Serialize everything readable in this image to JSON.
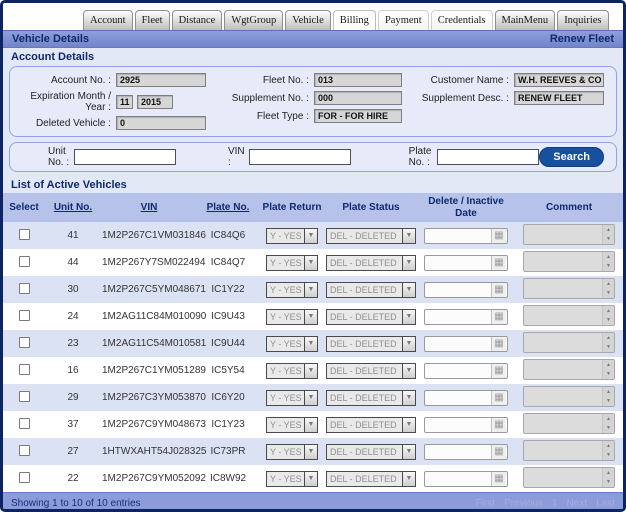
{
  "tabs": [
    {
      "label": "Account",
      "style": "gray"
    },
    {
      "label": "Fleet",
      "style": "gray"
    },
    {
      "label": "Distance",
      "style": "gray"
    },
    {
      "label": "WgtGroup",
      "style": "gray"
    },
    {
      "label": "Vehicle",
      "style": "gray"
    },
    {
      "label": "Billing",
      "style": "active"
    },
    {
      "label": "Payment",
      "style": "light"
    },
    {
      "label": "Credentials",
      "style": "light"
    },
    {
      "label": "MainMenu",
      "style": "gray"
    },
    {
      "label": "Inquiries",
      "style": "gray"
    }
  ],
  "title_bar": {
    "title": "Vehicle Details",
    "action": "Renew Fleet"
  },
  "account_details": {
    "section_title": "Account Details",
    "account_no": {
      "label": "Account No. :",
      "value": "2925"
    },
    "expiration": {
      "label": "Expiration Month / Year :",
      "month": "11",
      "year": "2015"
    },
    "deleted_vehicle": {
      "label": "Deleted Vehicle :",
      "value": "0"
    },
    "fleet_no": {
      "label": "Fleet No. :",
      "value": "013"
    },
    "supplement_no": {
      "label": "Supplement No. :",
      "value": "000"
    },
    "fleet_type": {
      "label": "Fleet Type :",
      "value": "FOR - FOR HIRE"
    },
    "customer_name": {
      "label": "Customer Name :",
      "value": "W.H. REEVES & CO INC"
    },
    "supplement_desc": {
      "label": "Supplement Desc. :",
      "value": "RENEW FLEET"
    }
  },
  "search": {
    "unit_no_label": "Unit No. :",
    "vin_label": "VIN :",
    "plate_no_label": "Plate No. :",
    "unit_no_value": "",
    "vin_value": "",
    "plate_no_value": "",
    "button_label": "Search"
  },
  "vehicle_list": {
    "section_title": "List of Active Vehicles",
    "columns": [
      {
        "label": "Select",
        "sortable": false
      },
      {
        "label": "Unit No.",
        "sortable": true
      },
      {
        "label": "VIN",
        "sortable": true
      },
      {
        "label": "Plate No.",
        "sortable": true
      },
      {
        "label": "Plate Return",
        "sortable": false
      },
      {
        "label": "Plate Status",
        "sortable": false
      },
      {
        "label": "Delete / Inactive Date",
        "sortable": false
      },
      {
        "label": "Comment",
        "sortable": false
      }
    ],
    "rows": [
      {
        "unit": "41",
        "vin": "1M2P267C1VM031846",
        "plate": "IC84Q6",
        "plate_return": "Y - YES",
        "plate_status": "DEL - DELETED",
        "delete_date": "",
        "comment": ""
      },
      {
        "unit": "44",
        "vin": "1M2P267Y7SM022494",
        "plate": "IC84Q7",
        "plate_return": "Y - YES",
        "plate_status": "DEL - DELETED",
        "delete_date": "",
        "comment": ""
      },
      {
        "unit": "30",
        "vin": "1M2P267C5YM048671",
        "plate": "IC1Y22",
        "plate_return": "Y - YES",
        "plate_status": "DEL - DELETED",
        "delete_date": "",
        "comment": ""
      },
      {
        "unit": "24",
        "vin": "1M2AG11C84M010090",
        "plate": "IC9U43",
        "plate_return": "Y - YES",
        "plate_status": "DEL - DELETED",
        "delete_date": "",
        "comment": ""
      },
      {
        "unit": "23",
        "vin": "1M2AG11C54M010581",
        "plate": "IC9U44",
        "plate_return": "Y - YES",
        "plate_status": "DEL - DELETED",
        "delete_date": "",
        "comment": ""
      },
      {
        "unit": "16",
        "vin": "1M2P267C1YM051289",
        "plate": "IC5Y54",
        "plate_return": "Y - YES",
        "plate_status": "DEL - DELETED",
        "delete_date": "",
        "comment": ""
      },
      {
        "unit": "29",
        "vin": "1M2P267C3YM053870",
        "plate": "IC6Y20",
        "plate_return": "Y - YES",
        "plate_status": "DEL - DELETED",
        "delete_date": "",
        "comment": ""
      },
      {
        "unit": "37",
        "vin": "1M2P267C9YM048673",
        "plate": "IC1Y23",
        "plate_return": "Y - YES",
        "plate_status": "DEL - DELETED",
        "delete_date": "",
        "comment": ""
      },
      {
        "unit": "27",
        "vin": "1HTWXAHT54J028325",
        "plate": "IC73PR",
        "plate_return": "Y - YES",
        "plate_status": "DEL - DELETED",
        "delete_date": "",
        "comment": ""
      },
      {
        "unit": "22",
        "vin": "1M2P267C9YM052092",
        "plate": "IC8W92",
        "plate_return": "Y - YES",
        "plate_status": "DEL - DELETED",
        "delete_date": "",
        "comment": ""
      }
    ]
  },
  "footer": {
    "status": "Showing 1 to 10 of 10 entries",
    "pagination": [
      "First",
      "Previous",
      "1",
      "Next",
      "Last"
    ]
  },
  "colors": {
    "outer_border": "#0d2463",
    "title_bar_bg": "#7c8dd0",
    "content_bg": "#e3e8f6",
    "table_header_bg": "#b6c2e9",
    "row_alt_bg": "#dbe2f4",
    "footer_bg": "#8c9bd9",
    "search_button_bg": "#17509e",
    "heading_text": "#0d2a70"
  }
}
